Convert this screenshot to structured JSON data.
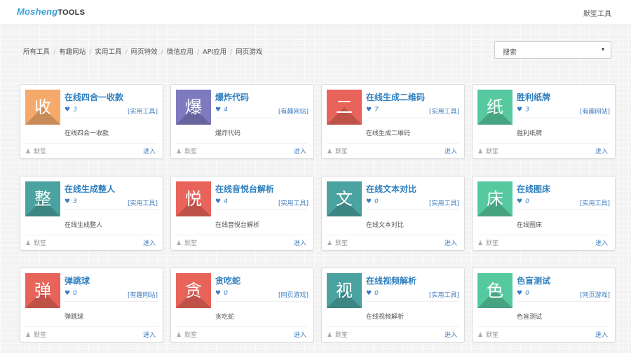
{
  "header": {
    "brand": "Mosheng",
    "brand_suffix": "TOOLS",
    "right_link": "默笙工具"
  },
  "breadcrumbs": [
    "所有工具",
    "有趣网站",
    "实用工具",
    "网页特效",
    "微信应用",
    "API应用",
    "网页游戏"
  ],
  "search": {
    "placeholder": "搜索",
    "caret": "▾"
  },
  "colors": {
    "orange": "#f5a96b",
    "purple": "#7d7abf",
    "red": "#e8645a",
    "teal": "#4aa3a0",
    "green": "#57c9a0",
    "link": "#2e7fbf"
  },
  "cards": [
    {
      "char": "收",
      "color": "#f5a96b",
      "title": "在线四合一收款",
      "likes": "3",
      "category": "[实用工具]",
      "desc": "在线四合一收款",
      "author": "默笙",
      "enter": "进入"
    },
    {
      "char": "爆",
      "color": "#7d7abf",
      "title": "爆炸代码",
      "likes": "4",
      "category": "[有趣网站]",
      "desc": "爆炸代码",
      "author": "默笙",
      "enter": "进入"
    },
    {
      "char": "二",
      "color": "#e8645a",
      "title": "在线生成二维码",
      "likes": "7",
      "category": "[实用工具]",
      "desc": "在线生成二维码",
      "author": "默笙",
      "enter": "进入"
    },
    {
      "char": "纸",
      "color": "#57c9a0",
      "title": "胜利纸牌",
      "likes": "3",
      "category": "[有趣网站]",
      "desc": "胜利纸牌",
      "author": "默笙",
      "enter": "进入"
    },
    {
      "char": "整",
      "color": "#4aa3a0",
      "title": "在线生成整人",
      "likes": "3",
      "category": "[实用工具]",
      "desc": "在线生成整人",
      "author": "默笙",
      "enter": "进入"
    },
    {
      "char": "悦",
      "color": "#e8645a",
      "title": "在线音悦台解析",
      "likes": "4",
      "category": "[实用工具]",
      "desc": "在线音悦台解析",
      "author": "默笙",
      "enter": "进入"
    },
    {
      "char": "文",
      "color": "#4aa3a0",
      "title": "在线文本对比",
      "likes": "0",
      "category": "[实用工具]",
      "desc": "在线文本对比",
      "author": "默笙",
      "enter": "进入"
    },
    {
      "char": "床",
      "color": "#57c9a0",
      "title": "在线图床",
      "likes": "0",
      "category": "[实用工具]",
      "desc": "在线图床",
      "author": "默笙",
      "enter": "进入"
    },
    {
      "char": "弹",
      "color": "#e8645a",
      "title": "弹跳球",
      "likes": "0",
      "category": "[有趣网站]",
      "desc": "弹跳球",
      "author": "默笙",
      "enter": "进入"
    },
    {
      "char": "贪",
      "color": "#e8645a",
      "title": "贪吃蛇",
      "likes": "0",
      "category": "[网页游戏]",
      "desc": "贪吃蛇",
      "author": "默笙",
      "enter": "进入"
    },
    {
      "char": "视",
      "color": "#4aa3a0",
      "title": "在线视频解析",
      "likes": "0",
      "category": "[实用工具]",
      "desc": "在线视频解析",
      "author": "默笙",
      "enter": "进入"
    },
    {
      "char": "色",
      "color": "#57c9a0",
      "title": "色盲测试",
      "likes": "0",
      "category": "[网页游戏]",
      "desc": "色盲测试",
      "author": "默笙",
      "enter": "进入"
    }
  ]
}
